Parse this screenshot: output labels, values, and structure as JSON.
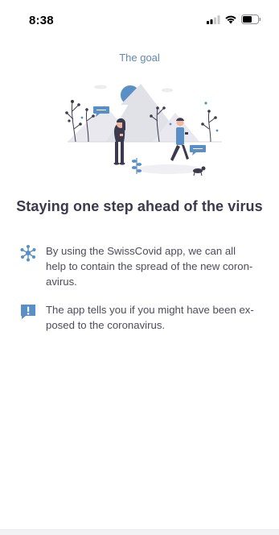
{
  "status_bar": {
    "time": "8:38",
    "icons": [
      "signal-icon",
      "wifi-icon",
      "battery-icon"
    ]
  },
  "onboarding": {
    "kicker": "The goal",
    "headline": "Staying one step ahead of the virus",
    "illustration": "people-walking-mountains-illustration",
    "items": [
      {
        "icon": "network-icon",
        "text": "By using the SwissCovid app, we can all\nhelp to contain the spread of the new coron-\navirus."
      },
      {
        "icon": "exclamation-message-icon",
        "text": "The app tells you if you might have been ex-\nposed to the coronavirus."
      }
    ]
  },
  "colors": {
    "accent": "#5f88b3",
    "text": "#3b3a4c",
    "icon_blue": "#5a8fc6"
  }
}
